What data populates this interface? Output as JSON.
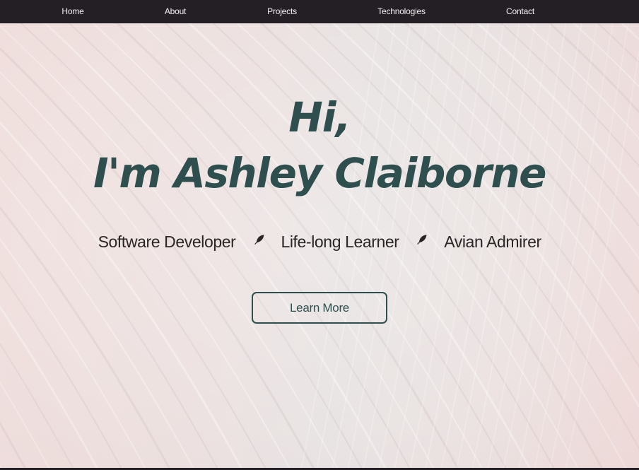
{
  "nav": {
    "items": [
      {
        "label": "Home"
      },
      {
        "label": "About"
      },
      {
        "label": "Projects"
      },
      {
        "label": "Technologies"
      },
      {
        "label": "Contact"
      }
    ]
  },
  "hero": {
    "greeting_line1": "Hi,",
    "greeting_line2": "I'm Ashley Claiborne",
    "taglines": [
      "Software Developer",
      "Life-long Learner",
      "Avian Admirer"
    ],
    "separator_icon": "feather-icon",
    "cta_label": "Learn More"
  },
  "colors": {
    "nav_background": "#231f24",
    "nav_text": "#f4f0f2",
    "accent": "#2f4f4e",
    "body_text": "#2a2626",
    "hero_background": "#efe3e1"
  }
}
